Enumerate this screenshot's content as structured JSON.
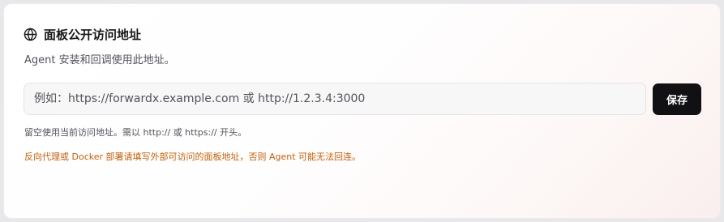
{
  "section": {
    "title": "面板公开访问地址",
    "title_icon": "globe-icon",
    "description": "Agent 安装和回调使用此地址。"
  },
  "url_input": {
    "value": "",
    "placeholder": "例如：https://forwardx.example.com 或 http://1.2.3.4:3000"
  },
  "save_button": {
    "label": "保存"
  },
  "hint": "留空使用当前访问地址。需以 http:// 或 https:// 开头。",
  "warning": "反向代理或 Docker 部署请填写外部可访问的面板地址，否则 Agent 可能无法回连。",
  "colors": {
    "warning": "#c2610c",
    "button_bg": "#111113",
    "title": "#18181b"
  }
}
